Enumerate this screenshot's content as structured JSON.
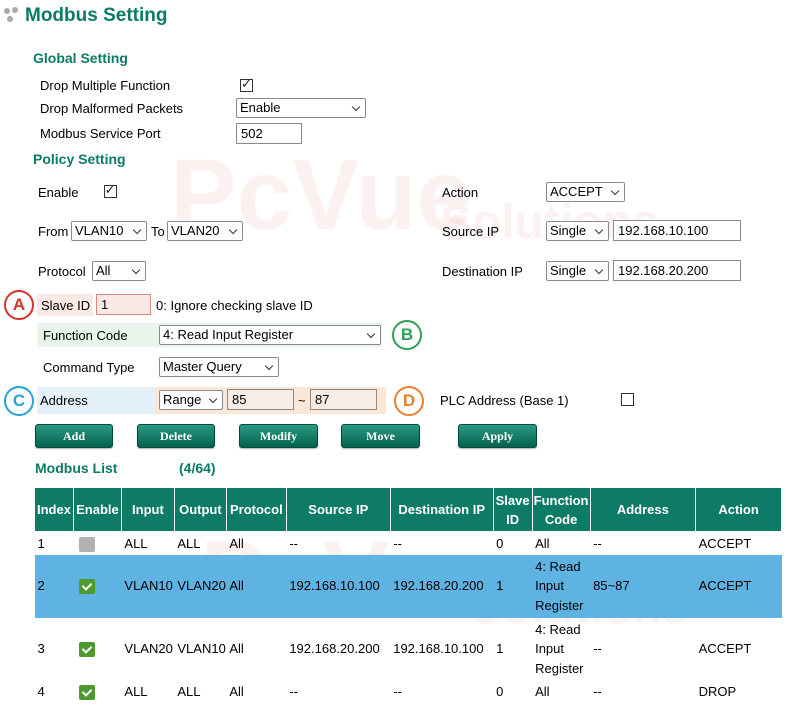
{
  "page": {
    "title": "Modbus Setting"
  },
  "global": {
    "heading": "Global Setting",
    "drop_multiple_function": {
      "label": "Drop Multiple Function",
      "checked": true
    },
    "drop_malformed": {
      "label": "Drop Malformed Packets",
      "value": "Enable"
    },
    "service_port": {
      "label": "Modbus Service Port",
      "value": "502"
    }
  },
  "policy": {
    "heading": "Policy Setting",
    "enable_label": "Enable",
    "enable_checked": true,
    "from_label": "From",
    "from_value": "VLAN10",
    "to_label": "To",
    "to_value": "VLAN20",
    "protocol_label": "Protocol",
    "protocol_value": "All",
    "action_label": "Action",
    "action_value": "ACCEPT",
    "source_ip_label": "Source IP",
    "source_ip_mode": "Single",
    "source_ip_value": "192.168.10.100",
    "dest_ip_label": "Destination IP",
    "dest_ip_mode": "Single",
    "dest_ip_value": "192.168.20.200",
    "slave_id_label": "Slave ID",
    "slave_id_value": "1",
    "slave_id_hint": "0: Ignore checking slave ID",
    "function_code_label": "Function Code",
    "function_code_value": "4: Read Input Register",
    "command_type_label": "Command Type",
    "command_type_value": "Master Query",
    "address_label": "Address",
    "address_mode": "Range",
    "address_from": "85",
    "address_sep": "~",
    "address_to": "87",
    "plc_label": "PLC Address (Base 1)",
    "plc_checked": false
  },
  "badges": {
    "a": "A",
    "b": "B",
    "c": "C",
    "d": "D"
  },
  "badge_colors": {
    "a": "#d9312b",
    "b": "#2e9e57",
    "c": "#27a3dc",
    "d": "#e6822e"
  },
  "buttons": {
    "add": "Add",
    "delete": "Delete",
    "modify": "Modify",
    "move": "Move",
    "apply": "Apply"
  },
  "list": {
    "heading": "Modbus List",
    "count": "(4/64)",
    "columns": [
      "Index",
      "Enable",
      "Input",
      "Output",
      "Protocol",
      "Source IP",
      "Destination IP",
      "Slave ID",
      "Function Code",
      "Address",
      "Action"
    ],
    "rows": [
      {
        "index": "1",
        "enabled": false,
        "input": "ALL",
        "output": "ALL",
        "protocol": "All",
        "source": "--",
        "dest": "--",
        "slave": "0",
        "func": "All",
        "address": "--",
        "action": "ACCEPT"
      },
      {
        "index": "2",
        "enabled": true,
        "input": "VLAN10",
        "output": "VLAN20",
        "protocol": "All",
        "source": "192.168.10.100",
        "dest": "192.168.20.200",
        "slave": "1",
        "func": "4: Read Input Register",
        "address": "85~87",
        "action": "ACCEPT"
      },
      {
        "index": "3",
        "enabled": true,
        "input": "VLAN20",
        "output": "VLAN10",
        "protocol": "All",
        "source": "192.168.20.200",
        "dest": "192.168.10.100",
        "slave": "1",
        "func": "4: Read Input Register",
        "address": "--",
        "action": "ACCEPT"
      },
      {
        "index": "4",
        "enabled": true,
        "input": "ALL",
        "output": "ALL",
        "protocol": "All",
        "source": "--",
        "dest": "--",
        "slave": "0",
        "func": "All",
        "address": "--",
        "action": "DROP"
      }
    ]
  },
  "colors": {
    "accent": "#0b7b67",
    "header_bg": "#0d7b66",
    "selected_row": "#5fb3e3",
    "tick_green": "#4e9a2f"
  },
  "watermark": {
    "text": "PcVue",
    "subtext": "Solutions"
  }
}
